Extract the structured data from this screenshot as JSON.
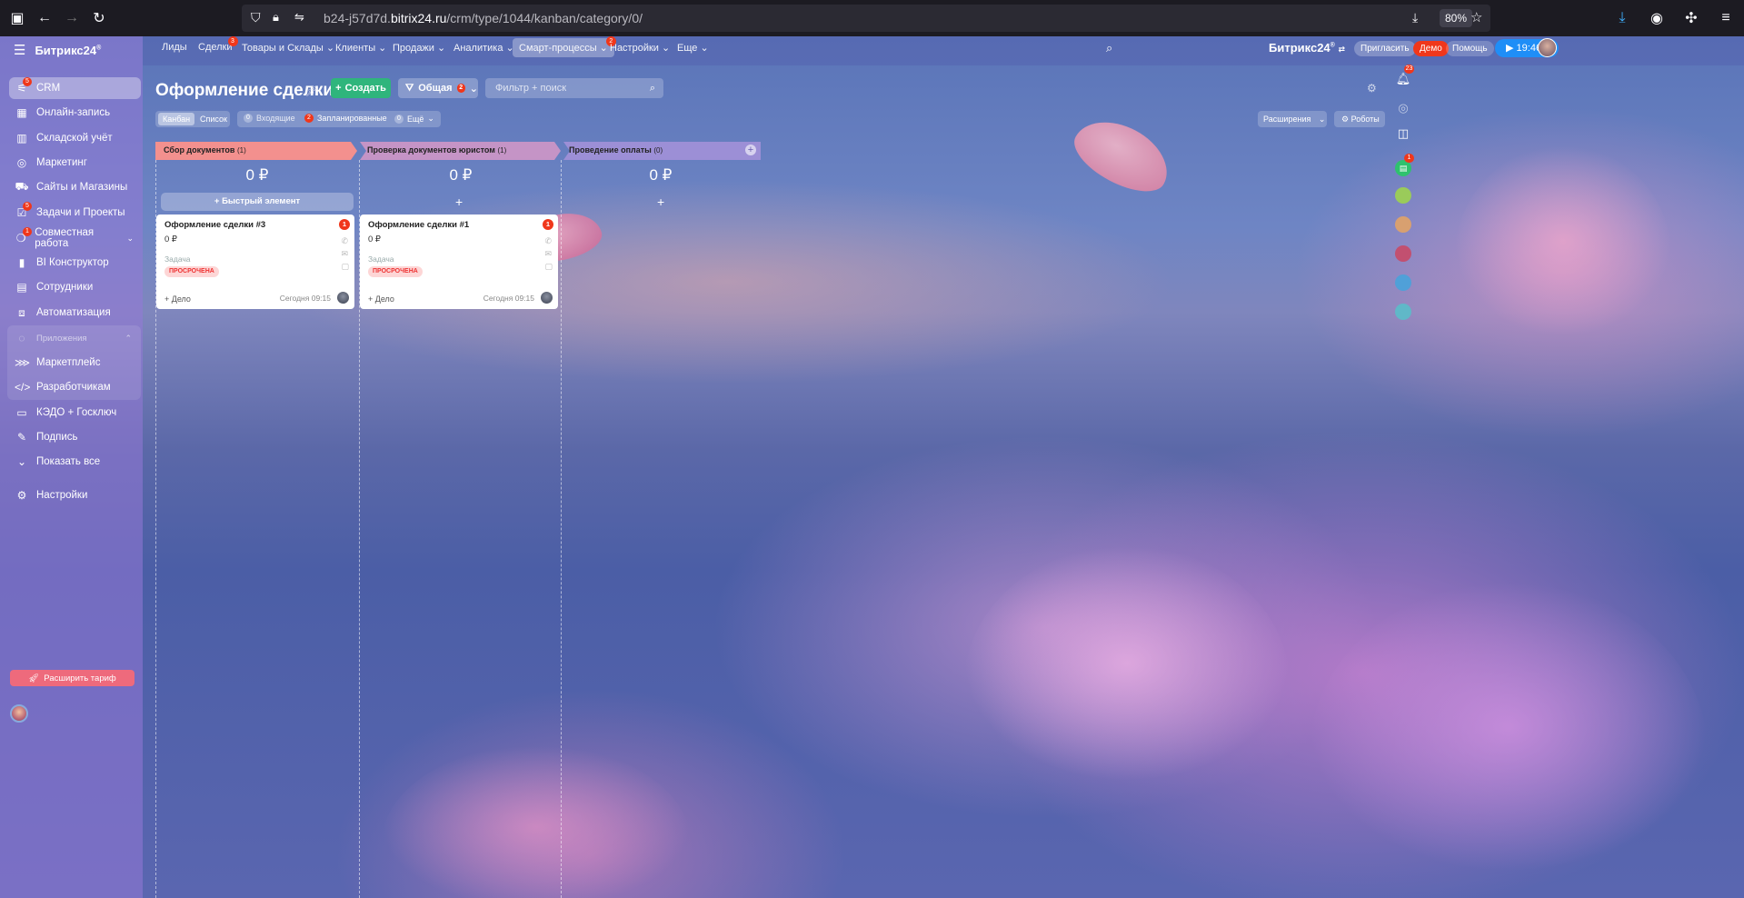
{
  "browser": {
    "url_prefix": "b24-j57d7d.",
    "url_host": "bitrix24.ru",
    "url_path": "/crm/type/1044/kanban/category/0/",
    "zoom": "80%"
  },
  "sidebar": {
    "brand": "Битрикс24",
    "brand_mark": "®",
    "items": [
      {
        "label": "CRM",
        "badge": "5"
      },
      {
        "label": "Онлайн-запись"
      },
      {
        "label": "Складской учёт"
      },
      {
        "label": "Маркетинг"
      },
      {
        "label": "Сайты и Магазины"
      },
      {
        "label": "Задачи и Проекты",
        "badge": "5"
      },
      {
        "label": "Совместная работа",
        "badge": "1"
      },
      {
        "label": "BI Конструктор"
      },
      {
        "label": "Сотрудники"
      },
      {
        "label": "Автоматизация"
      }
    ],
    "apps_header": "Приложения",
    "apps_items": [
      {
        "label": "Маркетплейс"
      },
      {
        "label": "Разработчикам"
      }
    ],
    "tail_items": [
      {
        "label": "КЭДО + Госключ"
      },
      {
        "label": "Подпись"
      },
      {
        "label": "Показать все"
      },
      {
        "label": "Настройки"
      }
    ],
    "expand_button": "Расширить тариф"
  },
  "topnav": {
    "items": [
      {
        "label": "Лиды"
      },
      {
        "label": "Сделки",
        "badge": "3"
      },
      {
        "label": "Товары и Склады"
      },
      {
        "label": "Клиенты"
      },
      {
        "label": "Продажи"
      },
      {
        "label": "Аналитика"
      },
      {
        "label": "Смарт-процессы",
        "badge": "2"
      },
      {
        "label": "Настройки"
      },
      {
        "label": "Еще"
      }
    ],
    "brand": "Битрикс24",
    "invite": "Пригласить",
    "demo": "Демо",
    "help": "Помощь",
    "time": "19:46"
  },
  "toolbar": {
    "title": "Оформление сделки",
    "create": "Создать",
    "general": "Общая",
    "general_badge": "2",
    "search_placeholder": "Фильтр + поиск",
    "view_kanban": "Канбан",
    "view_list": "Список",
    "incoming_count": "0",
    "incoming": "Входящие",
    "planned_count": "2",
    "planned": "Запланированные",
    "more_count": "0",
    "more": "Ещё",
    "extensions": "Расширения",
    "robots": "Роботы"
  },
  "kanban": {
    "columns": [
      {
        "title": "Сбор документов",
        "count": "(1)",
        "color": "#f3908e",
        "sum": "0 ₽"
      },
      {
        "title": "Проверка документов юристом",
        "count": "(1)",
        "color": "#c594c6",
        "sum": "0 ₽"
      },
      {
        "title": "Проведение оплаты",
        "count": "(0)",
        "color": "#9c8fd6",
        "sum": "0 ₽"
      }
    ],
    "quick_item": "Быстрый элемент",
    "cards": [
      {
        "title": "Оформление сделки #3",
        "sum": "0 ₽",
        "type": "Задача",
        "status": "ПРОСРОЧЕНА",
        "add": "+ Дело",
        "date": "Сегодня 09:15",
        "badge": "1"
      },
      {
        "title": "Оформление сделки #1",
        "sum": "0 ₽",
        "type": "Задача",
        "status": "ПРОСРОЧЕНА",
        "add": "+ Дело",
        "date": "Сегодня 09:15",
        "badge": "1"
      }
    ]
  },
  "right_rail": {
    "notifications_badge": "23",
    "chat_badge": "1"
  }
}
